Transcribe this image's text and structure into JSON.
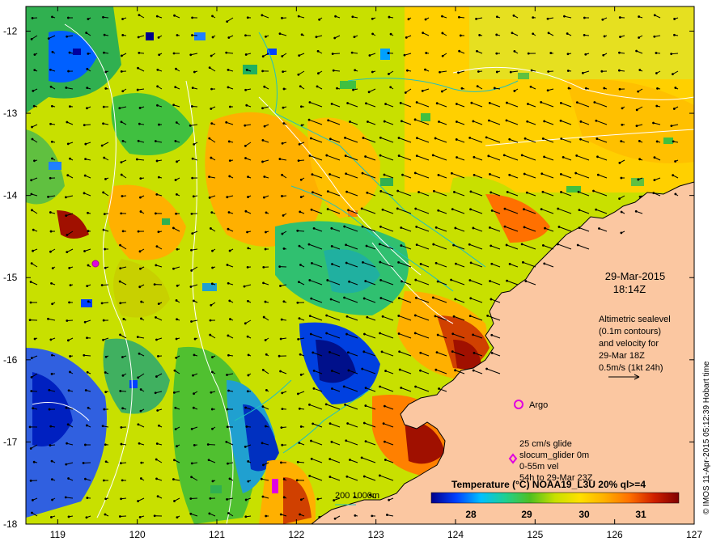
{
  "map": {
    "x_ticks": [
      "119",
      "120",
      "121",
      "122",
      "123",
      "124",
      "125",
      "126",
      "127"
    ],
    "y_ticks": [
      "-12",
      "-13",
      "-14",
      "-15",
      "-16",
      "-17",
      "-18"
    ],
    "date": "29-Mar-2015",
    "time": "18:14Z",
    "altimetry_lines": [
      "Altimetric sealevel",
      "(0.1m contours)",
      "and velocity for",
      "29-Mar 18Z",
      "0.5m/s (1kt 24h)"
    ],
    "argo_label": "Argo",
    "glider_lines": [
      "25 cm/s glide",
      "slocum_glider 0m",
      "0-55m vel",
      "54h to 29-Mar 23Z"
    ],
    "depth_contours_label": "200  1000m",
    "colorbar": {
      "title": "Temperature (°C) NOAA19_L3U 20% ql>=4",
      "ticks": [
        "28",
        "29",
        "30",
        "31"
      ],
      "colors": [
        "#00008b",
        "#0040ff",
        "#00c0ff",
        "#20d090",
        "#50c020",
        "#c8e000",
        "#ffe000",
        "#ffb000",
        "#ff7000",
        "#d02000",
        "#800000"
      ]
    },
    "credit": "© IMOS 11-Apr-2015 05:12:39 Hobart time",
    "colors": {
      "land": "#fbc7a1",
      "coast": "#000000",
      "depth_contour": "#20c0c0",
      "sealevel_contour": "#ffffff",
      "argo": "#e000e0",
      "glider": "#e000e0"
    }
  }
}
